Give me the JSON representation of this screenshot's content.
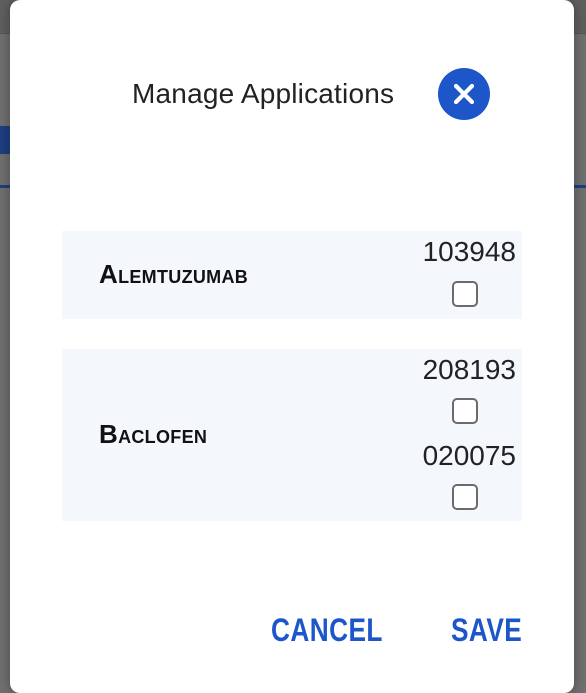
{
  "dialog": {
    "title": "Manage Applications",
    "close_icon": "close-icon",
    "accent_color": "#1d56c8"
  },
  "drugs": [
    {
      "name": "Alemtuzumab",
      "applications": [
        {
          "number": "103948",
          "checked": false
        }
      ]
    },
    {
      "name": "Baclofen",
      "applications": [
        {
          "number": "208193",
          "checked": false
        },
        {
          "number": "020075",
          "checked": false
        }
      ]
    }
  ],
  "footer": {
    "cancel_label": "CANCEL",
    "save_label": "SAVE"
  }
}
